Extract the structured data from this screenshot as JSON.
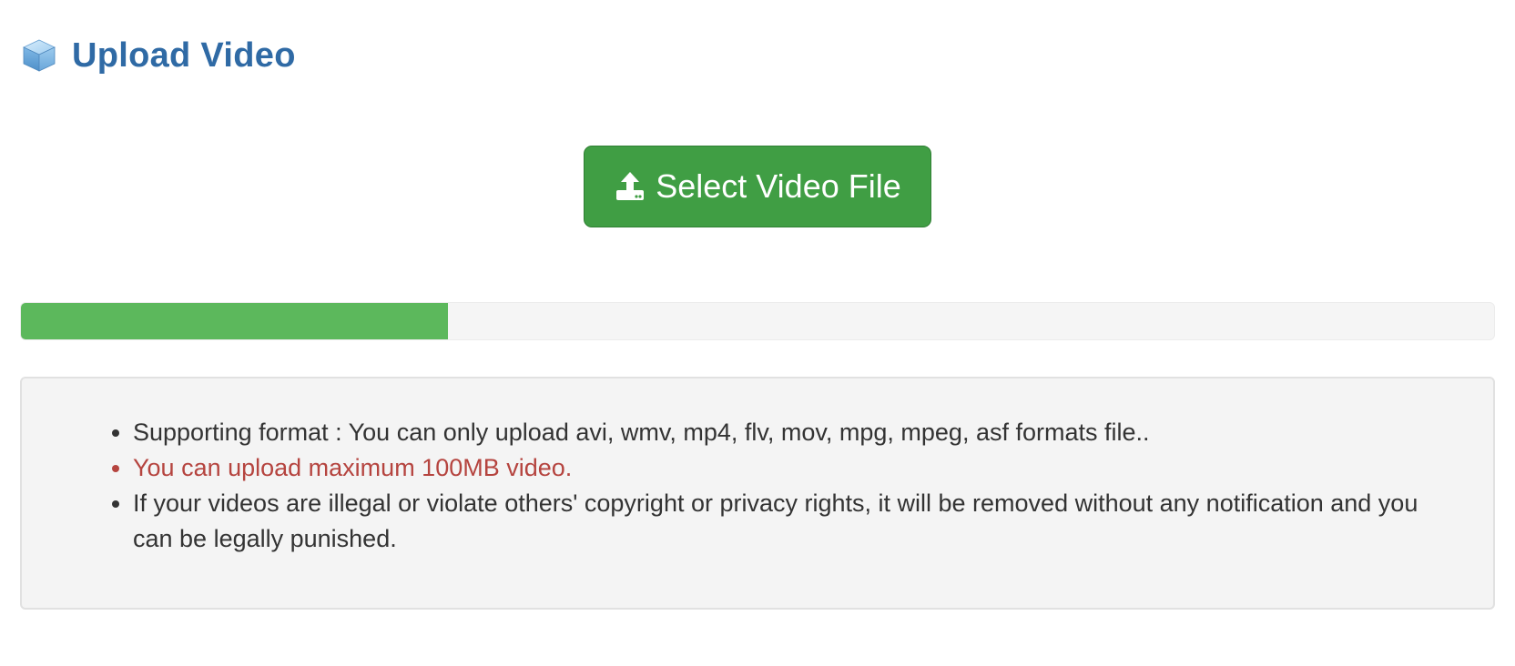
{
  "header": {
    "icon": "cube-icon",
    "title": "Upload Video"
  },
  "upload_button": {
    "icon": "upload-icon",
    "label": "Select Video File",
    "color": "#409e44"
  },
  "progress": {
    "percent": 29,
    "fill_color": "#5cb85c",
    "track_color": "#f5f5f5"
  },
  "notes": {
    "items": [
      {
        "text": "Supporting format : You can only upload avi, wmv, mp4, flv, mov, mpg, mpeg, asf formats file..",
        "color": "#333333"
      },
      {
        "text": "You can upload maximum 100MB video.",
        "color": "#b5443f"
      },
      {
        "text": "If your videos are illegal or violate others' copyright or privacy rights, it will be removed without any notification and you can be legally punished.",
        "color": "#333333"
      }
    ]
  },
  "colors": {
    "title": "#2f6aa5",
    "info_bg": "#f4f4f4"
  }
}
